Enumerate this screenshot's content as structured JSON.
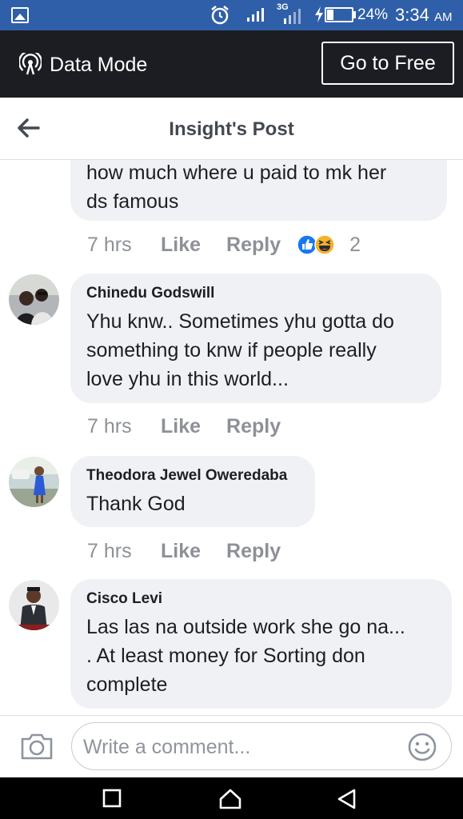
{
  "status_bar": {
    "network": "3G",
    "battery_percent": "24%",
    "battery_level": 0.24,
    "time": "3:34",
    "ampm": "AM"
  },
  "data_mode_bar": {
    "label": "Data Mode",
    "button": "Go to Free"
  },
  "header": {
    "title": "Insight's Post"
  },
  "comments": [
    {
      "name": "",
      "lines": [
        "how much where u paid to mk her",
        "ds famous"
      ],
      "time": "7 hrs",
      "like": "Like",
      "reply": "Reply",
      "reaction_icons": [
        "like-reaction-icon",
        "haha-reaction-icon"
      ],
      "reaction_count": "2"
    },
    {
      "name": "Chinedu Godswill",
      "lines": [
        "Yhu knw.. Sometimes yhu gotta do",
        "something to knw if people really",
        "love yhu in this world..."
      ],
      "time": "7 hrs",
      "like": "Like",
      "reply": "Reply"
    },
    {
      "name": "Theodora Jewel Oweredaba",
      "lines": [
        "Thank God"
      ],
      "time": "7 hrs",
      "like": "Like",
      "reply": "Reply"
    },
    {
      "name": "Cisco Levi",
      "lines": [
        "Las las na outside work she go na...",
        ". At least money for Sorting don",
        "complete"
      ]
    }
  ],
  "composer": {
    "placeholder": "Write a comment..."
  },
  "colors": {
    "status_bar": "#2f5fa8",
    "data_bar": "#1b1d22",
    "bubble": "#f0f1f4",
    "muted_text": "#8d9197",
    "like_blue": "#1877f2"
  }
}
